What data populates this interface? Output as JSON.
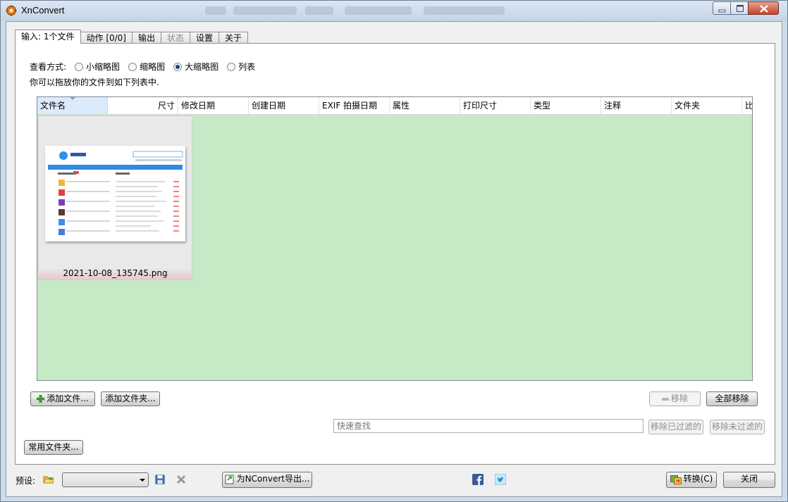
{
  "window": {
    "title": "XnConvert"
  },
  "tabs": [
    {
      "label": "输入: 1个文件",
      "active": true,
      "enabled": true
    },
    {
      "label": "动作 [0/0]",
      "active": false,
      "enabled": true
    },
    {
      "label": "输出",
      "active": false,
      "enabled": true
    },
    {
      "label": "状态",
      "active": false,
      "enabled": false
    },
    {
      "label": "设置",
      "active": false,
      "enabled": true
    },
    {
      "label": "关于",
      "active": false,
      "enabled": true
    }
  ],
  "view": {
    "label": "查看方式:",
    "options": [
      {
        "label": "小缩略图",
        "selected": false
      },
      {
        "label": "缩略图",
        "selected": false
      },
      {
        "label": "大缩略图",
        "selected": true
      },
      {
        "label": "列表",
        "selected": false
      }
    ],
    "hint": "你可以拖放你的文件到如下列表中."
  },
  "list": {
    "columns": [
      "文件名",
      "尺寸",
      "修改日期",
      "创建日期",
      "EXIF 拍摄日期",
      "属性",
      "打印尺寸",
      "类型",
      "注释",
      "文件夹",
      "比"
    ],
    "files": [
      {
        "name": "2021-10-08_135745.png"
      }
    ],
    "background": "#c6eac6"
  },
  "buttons": {
    "add_files": "添加文件...",
    "add_folder": "添加文件夹...",
    "remove": "移除",
    "remove_all": "全部移除",
    "remove_filtered": "移除已过滤的",
    "remove_unfiltered": "移除未过滤的",
    "favorite_folders": "常用文件夹...",
    "export": "为NConvert导出...",
    "convert": "转换(C)",
    "close": "关闭"
  },
  "search": {
    "placeholder": "快速查找"
  },
  "preset": {
    "label": "预设:",
    "value": ""
  },
  "icons": {
    "app": "xnconvert-gear-icon",
    "add": "green-plus-icon",
    "remove": "minus-icon",
    "folder": "folder-open-icon",
    "save": "floppy-save-icon",
    "delete": "grey-x-icon",
    "export": "export-script-icon",
    "facebook": "facebook-icon",
    "twitter": "twitter-icon",
    "convert": "convert-icon"
  }
}
